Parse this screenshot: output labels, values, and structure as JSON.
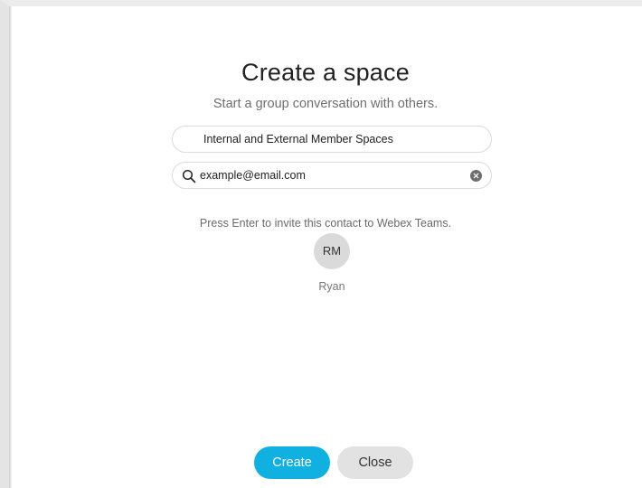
{
  "dialog": {
    "title": "Create a space",
    "subtitle": "Start a group conversation with others."
  },
  "space_name_field": {
    "value": "Internal and External Member Spaces"
  },
  "search_field": {
    "value": "example@email.com",
    "icon": "search-icon",
    "clear_icon": "clear-icon"
  },
  "hint": "Press Enter to invite this contact to Webex Teams.",
  "contact": {
    "initials": "RM",
    "name": "Ryan"
  },
  "buttons": {
    "create_label": "Create",
    "close_label": "Close"
  },
  "colors": {
    "accent": "#10b1e0",
    "secondary_button": "#e2e2e2",
    "avatar_bg": "#dadada"
  }
}
